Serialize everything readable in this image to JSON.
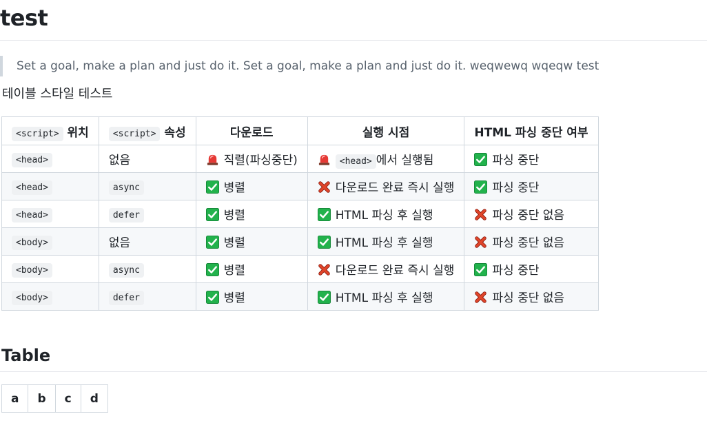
{
  "title": "test",
  "quote": "Set a goal, make a plan and just do it. Set a goal, make a plan and just do it. weqwewq wqeqw test",
  "paragraph": "테이블 스타일 테스트",
  "script_table": {
    "h0_code": "<script>",
    "h0_text": "위치",
    "h1_code": "<script>",
    "h1_text": "속성",
    "h2": "다운로드",
    "h3": "실행 시점",
    "h4": "HTML 파싱 중단 여부",
    "rows": [
      {
        "loc": "<head>",
        "attr": "없음",
        "attr_is_code": false,
        "dl_icon": "siren-icon",
        "dl": "직렬(파싱중단)",
        "ex_icon": "siren-icon",
        "ex_code": "<head>",
        "ex": "에서 실행됨",
        "st_icon": "check-mark-icon",
        "st": "파싱 중단"
      },
      {
        "loc": "<head>",
        "attr": "async",
        "attr_is_code": true,
        "dl_icon": "check-mark-icon",
        "dl": "병렬",
        "ex_icon": "cross-mark-icon",
        "ex_code": "",
        "ex": "다운로드 완료 즉시 실행",
        "st_icon": "check-mark-icon",
        "st": "파싱 중단"
      },
      {
        "loc": "<head>",
        "attr": "defer",
        "attr_is_code": true,
        "dl_icon": "check-mark-icon",
        "dl": "병렬",
        "ex_icon": "check-mark-icon",
        "ex_code": "",
        "ex": "HTML 파싱 후 실행",
        "st_icon": "cross-mark-icon",
        "st": "파싱 중단 없음"
      },
      {
        "loc": "<body>",
        "attr": "없음",
        "attr_is_code": false,
        "dl_icon": "check-mark-icon",
        "dl": "병렬",
        "ex_icon": "check-mark-icon",
        "ex_code": "",
        "ex": "HTML 파싱 후 실행",
        "st_icon": "cross-mark-icon",
        "st": "파싱 중단 없음"
      },
      {
        "loc": "<body>",
        "attr": "async",
        "attr_is_code": true,
        "dl_icon": "check-mark-icon",
        "dl": "병렬",
        "ex_icon": "cross-mark-icon",
        "ex_code": "",
        "ex": "다운로드 완료 즉시 실행",
        "st_icon": "check-mark-icon",
        "st": "파싱 중단"
      },
      {
        "loc": "<body>",
        "attr": "defer",
        "attr_is_code": true,
        "dl_icon": "check-mark-icon",
        "dl": "병렬",
        "ex_icon": "check-mark-icon",
        "ex_code": "",
        "ex": "HTML 파싱 후 실행",
        "st_icon": "cross-mark-icon",
        "st": "파싱 중단 없음"
      }
    ]
  },
  "section_heading": "Table",
  "small_table": {
    "headers": [
      "a",
      "b",
      "c",
      "d"
    ]
  },
  "colors": {
    "check_green": "#22b24c",
    "cross_red": "#d33e25",
    "siren_red": "#e53935"
  }
}
